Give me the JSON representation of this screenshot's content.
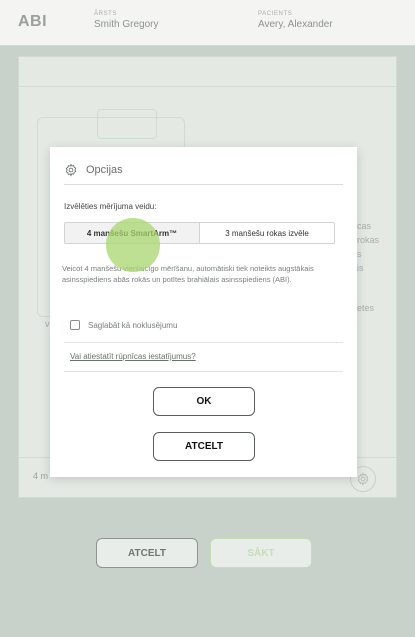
{
  "header": {
    "title": "ABI",
    "doctor_label": "ĀRSTS",
    "doctor_name": "Smith Gregory",
    "patient_label": "PACIENTS",
    "patient_name": "Avery, Alexander"
  },
  "background": {
    "side_text_1": "cas",
    "side_text_2": "rokas",
    "side_text_3": "s",
    "side_text_4": "is",
    "side_text_5": "etes",
    "left_text": "v",
    "bottom_text": "4 m",
    "cancel_label": "ATCELT",
    "start_label": "SĀKT"
  },
  "dialog": {
    "title": "Opcijas",
    "select_label": "Izvēlēties mērījuma veidu:",
    "options": [
      {
        "label": "4 manšešu SmartArm™",
        "selected": true
      },
      {
        "label": "3 manšešu rokas izvēle",
        "selected": false
      }
    ],
    "description": "Veicot 4 manšešu vienlaicīgo mērīšanu, automātiski tiek noteikts augstākais asinsspiediens abās rokās un potītes brahiālais asinsspiediens (ABI).",
    "checkbox_label": "Saglabāt kā noklusējumu",
    "checkbox_checked": false,
    "reset_link": "Vai atiestatīt rūpnīcas iestatījumus?",
    "ok_label": "OK",
    "cancel_label": "ATCELT"
  },
  "icons": {
    "settings": "gear-icon"
  }
}
